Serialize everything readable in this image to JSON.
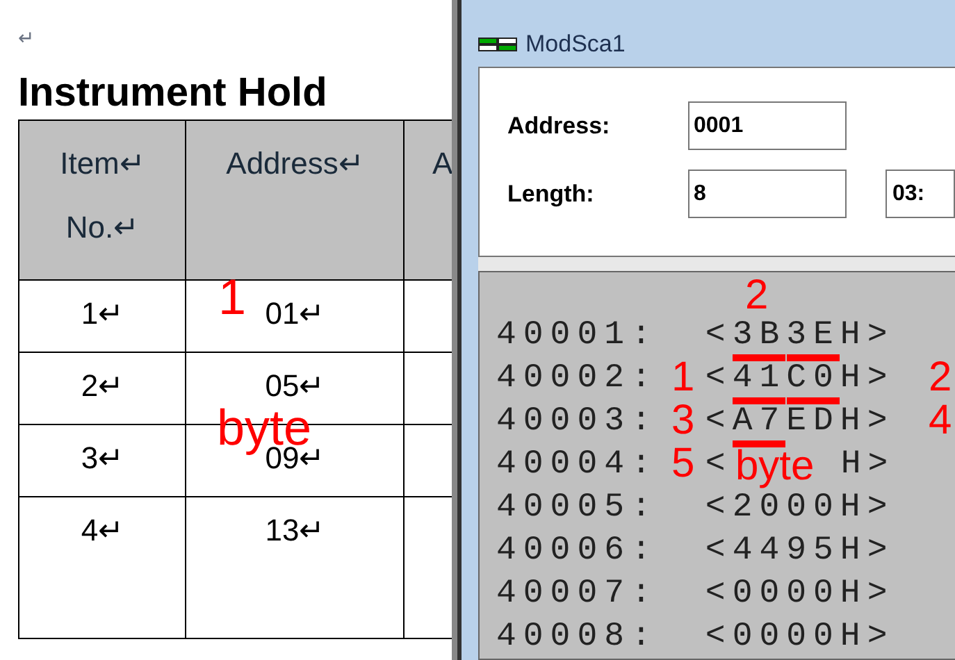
{
  "document": {
    "paragraph_mark": "↵",
    "heading": "Instrument Hold",
    "table": {
      "columns": [
        "Item↵ No.↵",
        "Address↵",
        "A"
      ],
      "rows": [
        [
          "1↵",
          "01↵"
        ],
        [
          "2↵",
          "05↵"
        ],
        [
          "3↵",
          "09↵"
        ],
        [
          "4↵",
          "13↵"
        ]
      ]
    }
  },
  "modscan": {
    "title": "ModSca1",
    "fields": [
      {
        "label": "Address:",
        "value": "0001"
      },
      {
        "label": "Length:",
        "value": "8"
      }
    ],
    "function_field": {
      "value": "03:"
    },
    "registers": [
      {
        "address": "40001:",
        "value": "<3B3EH>"
      },
      {
        "address": "40002:",
        "value": "<41C0H>"
      },
      {
        "address": "40003:",
        "value": "<A7EDH>"
      },
      {
        "address": "40004:",
        "value": "<",
        "value_after_note": "H>"
      },
      {
        "address": "40005:",
        "value": "<2000H>"
      },
      {
        "address": "40006:",
        "value": "<4495H>"
      },
      {
        "address": "40007:",
        "value": "<0000H>"
      },
      {
        "address": "40008:",
        "value": "<0000H>"
      }
    ]
  },
  "annotations": [
    {
      "kind": "text",
      "text": "1"
    },
    {
      "kind": "text",
      "text": "byte"
    },
    {
      "kind": "text",
      "text": "2"
    },
    {
      "kind": "text",
      "text": "1"
    },
    {
      "kind": "text",
      "text": "2"
    },
    {
      "kind": "text",
      "text": "3"
    },
    {
      "kind": "text",
      "text": "4"
    },
    {
      "kind": "text",
      "text": "5"
    },
    {
      "kind": "text",
      "text": "byte"
    },
    {
      "kind": "underline"
    },
    {
      "kind": "underline"
    },
    {
      "kind": "underline"
    },
    {
      "kind": "underline"
    },
    {
      "kind": "underline"
    }
  ]
}
